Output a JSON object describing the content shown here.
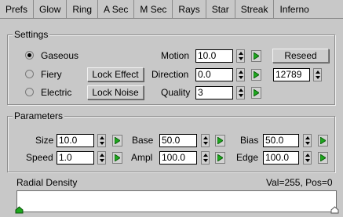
{
  "tabs": [
    "Prefs",
    "Glow",
    "Ring",
    "A Sec",
    "M Sec",
    "Rays",
    "Star",
    "Streak",
    "Inferno"
  ],
  "settings": {
    "title": "Settings",
    "radios": [
      {
        "label": "Gaseous",
        "selected": true
      },
      {
        "label": "Fiery",
        "selected": false
      },
      {
        "label": "Electric",
        "selected": false
      }
    ],
    "lock_effect": "Lock Effect",
    "lock_noise": "Lock Noise",
    "motion_label": "Motion",
    "motion_value": "10.0",
    "direction_label": "Direction",
    "direction_value": "0.0",
    "quality_label": "Quality",
    "quality_value": "3",
    "reseed": "Reseed",
    "seed_value": "12789"
  },
  "parameters": {
    "title": "Parameters",
    "size_label": "Size",
    "size_value": "10.0",
    "speed_label": "Speed",
    "speed_value": "1.0",
    "base_label": "Base",
    "base_value": "50.0",
    "ampl_label": "Ampl",
    "ampl_value": "100.0",
    "bias_label": "Bias",
    "bias_value": "50.0",
    "edge_label": "Edge",
    "edge_value": "100.0"
  },
  "radial": {
    "label": "Radial Density",
    "readout": "Val=255, Pos=0"
  },
  "colors": {
    "panel_bg": "#c8c8c8",
    "key_green": "#1ea81e",
    "field_bg": "#ffffff"
  }
}
